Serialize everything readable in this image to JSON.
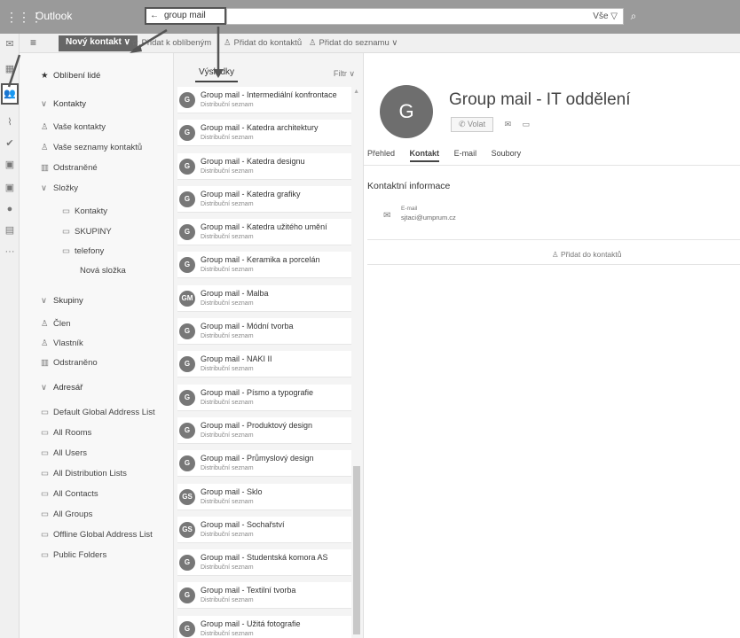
{
  "topbar": {
    "waffle_icon": "waffle-icon",
    "app_title": "Outlook",
    "search_value": "group mail",
    "search_back_glyph": "←",
    "scope": "Vše ▽"
  },
  "toolbar": {
    "new_contact": "Nový kontakt",
    "add_favorites": "Přidat k oblíbeným",
    "add_contacts": "Přidat do kontaktů",
    "add_list": "Přidat do seznamu"
  },
  "nav": {
    "favorites": "Oblíbení lidé",
    "contacts_header": "Kontakty",
    "your_contacts": "Vaše kontakty",
    "your_lists": "Vaše seznamy kontaktů",
    "deleted": "Odstraněné",
    "folders": "Složky",
    "folder_contacts": "Kontakty",
    "folder_groups": "SKUPINY",
    "folder_phones": "telefony",
    "new_folder": "Nová složka",
    "groups_header": "Skupiny",
    "member": "Člen",
    "owner": "Vlastník",
    "groups_deleted": "Odstraněno",
    "directory_header": "Adresář",
    "dir_items": [
      "Default Global Address List",
      "All Rooms",
      "All Users",
      "All Distribution Lists",
      "All Contacts",
      "All Groups",
      "Offline Global Address List",
      "Public Folders"
    ]
  },
  "results": {
    "tab": "Výsledky",
    "filter": "Filtr ∨",
    "subtitle": "Distribuční seznam",
    "items": [
      {
        "initials": "G",
        "name": "Group mail - Intermediální konfrontace"
      },
      {
        "initials": "G",
        "name": "Group mail - Katedra architektury"
      },
      {
        "initials": "G",
        "name": "Group mail - Katedra designu"
      },
      {
        "initials": "G",
        "name": "Group mail - Katedra grafiky"
      },
      {
        "initials": "G",
        "name": "Group mail - Katedra užitého umění"
      },
      {
        "initials": "G",
        "name": "Group mail - Keramika a porcelán"
      },
      {
        "initials": "GM",
        "name": "Group mail - Malba"
      },
      {
        "initials": "G",
        "name": "Group mail - Módní tvorba"
      },
      {
        "initials": "G",
        "name": "Group mail - NAKI II"
      },
      {
        "initials": "G",
        "name": "Group mail - Písmo a typografie"
      },
      {
        "initials": "G",
        "name": "Group mail - Produktový design"
      },
      {
        "initials": "G",
        "name": "Group mail - Průmyslový design"
      },
      {
        "initials": "GS",
        "name": "Group mail - Sklo"
      },
      {
        "initials": "GS",
        "name": "Group mail - Sochařství"
      },
      {
        "initials": "G",
        "name": "Group mail - Studentská komora AS"
      },
      {
        "initials": "G",
        "name": "Group mail - Textilní tvorba"
      },
      {
        "initials": "G",
        "name": "Group mail - Užitá fotografie"
      }
    ]
  },
  "details": {
    "avatar": "G",
    "title": "Group mail - IT oddělení",
    "call": "Volat",
    "tabs": [
      "Přehled",
      "Kontakt",
      "E-mail",
      "Soubory"
    ],
    "selected_tab": "Kontakt",
    "info_title": "Kontaktní informace",
    "email_label": "E-mail",
    "email_value": "sjtaci@umprum.cz",
    "add_contact": "Přidat do kontaktů"
  }
}
